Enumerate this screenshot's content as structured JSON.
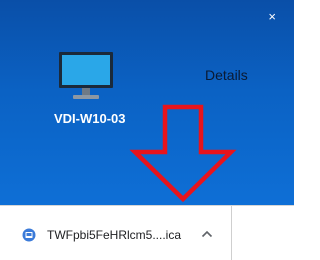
{
  "desktop": {
    "close_glyph": "×",
    "details_label": "Details",
    "vm": {
      "name": "VDI-W10-03",
      "icon": "monitor-icon"
    },
    "arrow_color": "#e8141c"
  },
  "download_bar": {
    "file_name": "TWFpbi5FeHRlcm5....ica",
    "file_icon": "citrix-receiver-icon",
    "menu_icon": "chevron-up-icon"
  }
}
